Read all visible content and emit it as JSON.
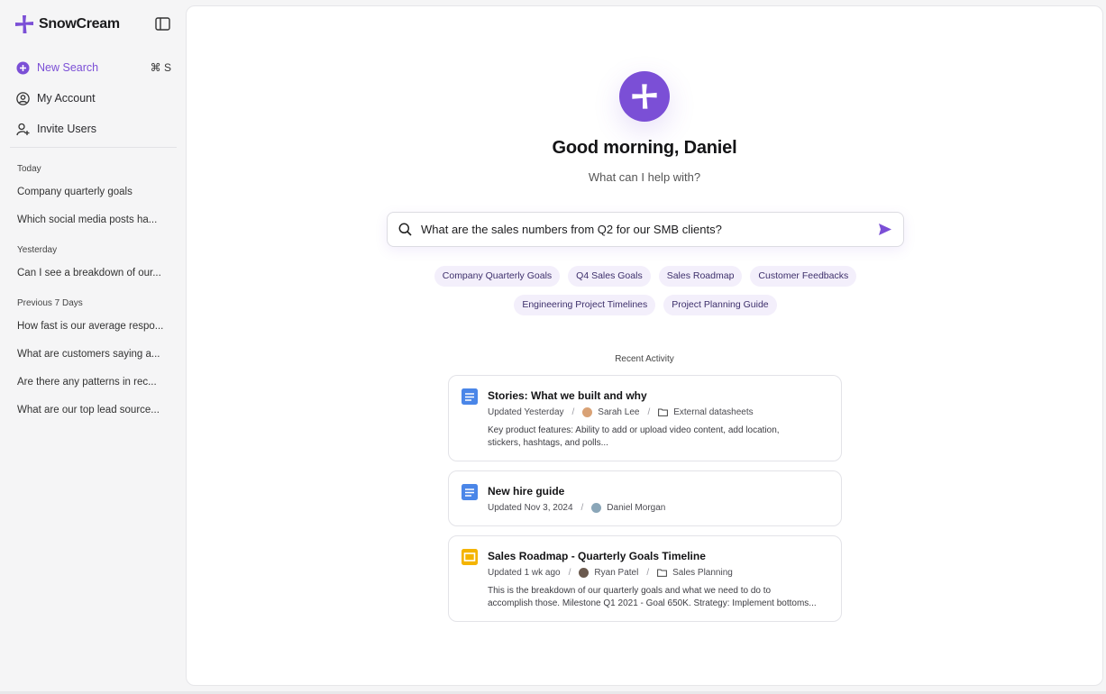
{
  "brand": {
    "name": "SnowCream",
    "accent": "#7b4fd6"
  },
  "nav": {
    "new_search": "New Search",
    "new_search_shortcut": "⌘ S",
    "my_account": "My Account",
    "invite_users": "Invite Users"
  },
  "history": {
    "groups": [
      {
        "title": "Today",
        "items": [
          "Company quarterly goals",
          "Which social media posts ha..."
        ]
      },
      {
        "title": "Yesterday",
        "items": [
          "Can I see a breakdown of our..."
        ]
      },
      {
        "title": "Previous 7 Days",
        "items": [
          "How fast is our average respo...",
          "What are customers saying a...",
          "Are there any patterns in rec...",
          "What are our top lead source..."
        ]
      }
    ]
  },
  "main": {
    "greeting": "Good morning, Daniel",
    "subgreeting": "What can I help with?",
    "search_value": "What are the sales numbers from Q2 for our SMB clients?",
    "chips": [
      "Company Quarterly Goals",
      "Q4 Sales Goals",
      "Sales Roadmap",
      "Customer Feedbacks",
      "Engineering Project Timelines",
      "Project Planning Guide"
    ],
    "recent_title": "Recent Activity",
    "cards": [
      {
        "title": "Stories: What we built and why",
        "updated": "Updated Yesterday",
        "author": "Sarah Lee",
        "folder": "External datasheets",
        "desc_lines": [
          "Key product features: Ability to add or upload video content, add location,",
          "stickers, hashtags, and polls..."
        ],
        "icon": "google-doc-icon"
      },
      {
        "title": "New hire guide",
        "updated": "Updated Nov 3, 2024",
        "author": "Daniel Morgan",
        "icon": "google-doc-icon"
      },
      {
        "title": "Sales Roadmap - Quarterly Goals Timeline",
        "updated": "Updated 1 wk ago",
        "author": "Ryan Patel",
        "folder": "Sales Planning",
        "desc_lines": [
          "This is the breakdown of our quarterly goals and what we need to do to",
          "accomplish those. Milestone Q1 2021 - Goal 650K. Strategy: Implement bottoms..."
        ],
        "icon": "google-slides-icon"
      }
    ]
  }
}
